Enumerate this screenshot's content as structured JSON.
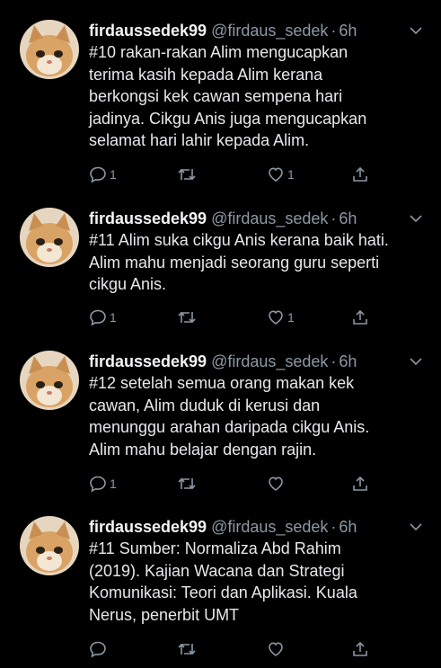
{
  "colors": {
    "background": "#000000",
    "text": "#e6e8ea",
    "secondary": "#8b98a5",
    "avatar_cat": "#d9a366"
  },
  "icons": {
    "reply": "comment-bubble-icon",
    "retweet": "retweet-icon",
    "like": "heart-icon",
    "share": "share-upload-icon",
    "menu": "chevron-down-icon"
  },
  "tweets": [
    {
      "display_name": "firdaussedek99",
      "handle": "@firdaus_sedek",
      "separator": "·",
      "time": "6h",
      "lines": [
        "#10 rakan-rakan Alim mengucapkan",
        "terima kasih kepada Alim kerana",
        "berkongsi kek cawan sempena hari",
        "jadinya. Cikgu Anis juga mengucapkan",
        "selamat hari lahir kepada Alim."
      ],
      "reply_count": "1",
      "retweet_count": "",
      "like_count": "1"
    },
    {
      "display_name": "firdaussedek99",
      "handle": "@firdaus_sedek",
      "separator": "·",
      "time": "6h",
      "lines": [
        "#11 Alim suka cikgu Anis kerana baik hati.",
        "Alim mahu menjadi seorang guru seperti",
        "cikgu Anis."
      ],
      "reply_count": "1",
      "retweet_count": "",
      "like_count": "1"
    },
    {
      "display_name": "firdaussedek99",
      "handle": "@firdaus_sedek",
      "separator": "·",
      "time": "6h",
      "lines": [
        "#12 setelah semua orang makan kek",
        "cawan, Alim duduk di kerusi dan",
        "menunggu arahan daripada cikgu Anis.",
        "Alim mahu belajar dengan rajin."
      ],
      "reply_count": "1",
      "retweet_count": "",
      "like_count": ""
    },
    {
      "display_name": "firdaussedek99",
      "handle": "@firdaus_sedek",
      "separator": "·",
      "time": "6h",
      "lines": [
        "#11 Sumber: Normaliza Abd Rahim",
        "(2019). Kajian Wacana dan Strategi",
        "Komunikasi: Teori dan Aplikasi.  Kuala",
        "Nerus, penerbit UMT"
      ],
      "reply_count": "",
      "retweet_count": "",
      "like_count": ""
    }
  ]
}
